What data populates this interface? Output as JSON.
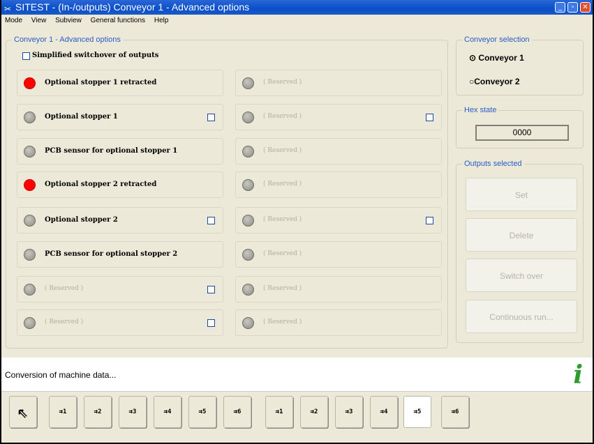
{
  "window": {
    "title": "SITEST - (In-/outputs) Conveyor 1 - Advanced options"
  },
  "menu": [
    "Mode",
    "View",
    "Subview",
    "General functions",
    "Help"
  ],
  "main": {
    "group_title": "Conveyor 1 - Advanced options",
    "simplified_label": "Simplified switchover of outputs",
    "left": [
      {
        "label": "Optional stopper 1 retracted",
        "state": "red",
        "checkbox": false
      },
      {
        "label": "Optional stopper 1",
        "state": "grey",
        "checkbox": true
      },
      {
        "label": "PCB sensor for optional stopper 1",
        "state": "grey",
        "checkbox": false
      },
      {
        "label": "Optional stopper 2 retracted",
        "state": "red",
        "checkbox": false
      },
      {
        "label": "Optional stopper 2",
        "state": "grey",
        "checkbox": true
      },
      {
        "label": "PCB sensor for optional stopper 2",
        "state": "grey",
        "checkbox": false
      },
      {
        "label": "( Reserved )",
        "state": "grey",
        "checkbox": true,
        "reserved": true
      },
      {
        "label": "( Reserved )",
        "state": "grey",
        "checkbox": true,
        "reserved": true
      }
    ],
    "right": [
      {
        "label": "( Reserved )",
        "checkbox": false
      },
      {
        "label": "( Reserved )",
        "checkbox": true
      },
      {
        "label": "( Reserved )",
        "checkbox": false
      },
      {
        "label": "( Reserved )",
        "checkbox": false
      },
      {
        "label": "( Reserved )",
        "checkbox": true
      },
      {
        "label": "( Reserved )",
        "checkbox": false
      },
      {
        "label": "( Reserved )",
        "checkbox": false
      },
      {
        "label": "( Reserved )",
        "checkbox": false
      }
    ]
  },
  "conveyor_selection": {
    "title": "Conveyor selection",
    "options": [
      "Conveyor 1",
      "Conveyor 2"
    ],
    "selected": "Conveyor 1"
  },
  "hex_state": {
    "title": "Hex state",
    "value": "0000"
  },
  "outputs": {
    "title": "Outputs selected",
    "buttons": [
      "Set",
      "Delete",
      "Switch over",
      "Continuous run..."
    ]
  },
  "status": {
    "message": "Conversion of machine data..."
  },
  "toolbar": [
    "",
    "1",
    "2",
    "3",
    "4",
    "5",
    "6",
    "1",
    "2",
    "3",
    "4",
    "5",
    "6"
  ],
  "colors": {
    "active_led": "#ff0000",
    "title_bar": "#0a4fc9"
  }
}
